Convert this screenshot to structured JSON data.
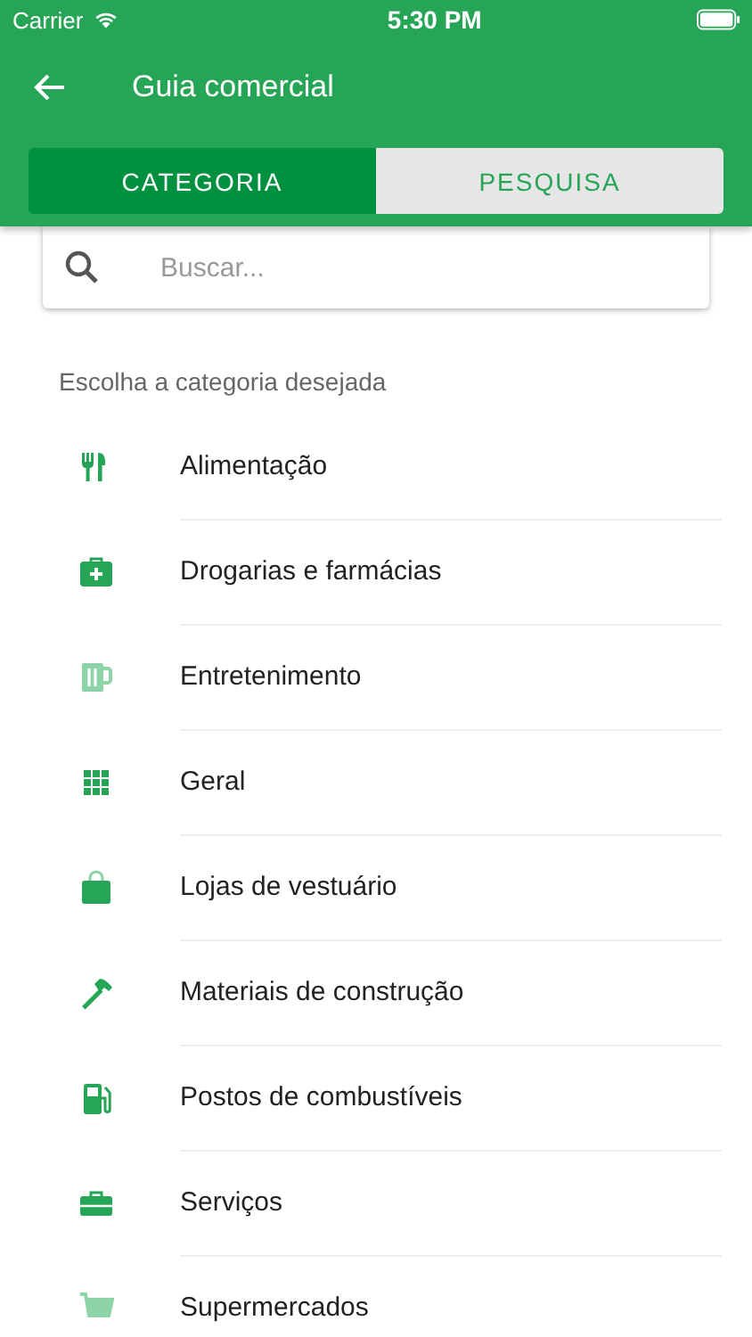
{
  "status_bar": {
    "carrier": "Carrier",
    "time": "5:30 PM"
  },
  "app_bar": {
    "title": "Guia comercial"
  },
  "tabs": [
    {
      "label": "CATEGORIA",
      "selected": true
    },
    {
      "label": "PESQUISA",
      "selected": false
    }
  ],
  "search": {
    "placeholder": "Buscar..."
  },
  "section_title": "Escolha a categoria desejada",
  "categories": [
    {
      "label": "Alimentação",
      "kind": "food"
    },
    {
      "label": "Drogarias e farmácias",
      "kind": "medkit"
    },
    {
      "label": "Entretenimento",
      "kind": "mug"
    },
    {
      "label": "Geral",
      "kind": "grid"
    },
    {
      "label": "Lojas de vestuário",
      "kind": "bag"
    },
    {
      "label": "Materiais de construção",
      "kind": "hammer"
    },
    {
      "label": "Postos de combustíveis",
      "kind": "fuel"
    },
    {
      "label": "Serviços",
      "kind": "toolbox"
    },
    {
      "label": "Supermercados",
      "kind": "cart"
    }
  ]
}
